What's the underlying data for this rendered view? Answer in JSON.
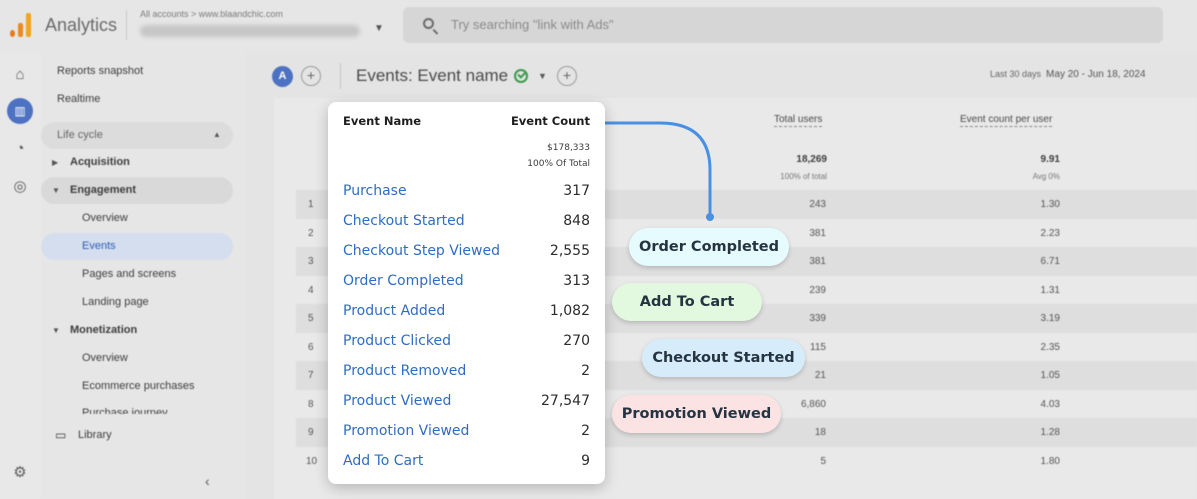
{
  "app": {
    "title": "Analytics",
    "breadcrumb": "All accounts > www.blaandchic.com",
    "search_placeholder": "Try searching \"link with Ads\""
  },
  "sidebar": {
    "reports_snapshot": "Reports snapshot",
    "realtime": "Realtime",
    "life_cycle": "Life cycle",
    "acquisition": "Acquisition",
    "engagement": "Engagement",
    "overview_1": "Overview",
    "events": "Events",
    "pages_and_screens": "Pages and screens",
    "landing_page": "Landing page",
    "monetization": "Monetization",
    "overview_2": "Overview",
    "ecommerce_purchases": "Ecommerce purchases",
    "purchase_journey": "Purchase journey",
    "library": "Library"
  },
  "report": {
    "avatar_letter": "A",
    "title": "Events: Event name",
    "date_label": "Last 30 days",
    "date_range": "May 20 - Jun 18, 2024"
  },
  "table": {
    "columns": [
      "Total users",
      "Event count per user"
    ],
    "totals": {
      "total_users": "18,269",
      "total_users_sub": "100% of total",
      "per_user": "9.91",
      "per_user_sub": "Avg 0%"
    },
    "rows": [
      {
        "n": "1",
        "users": "243",
        "per_user": "1.30"
      },
      {
        "n": "2",
        "users": "381",
        "per_user": "2.23"
      },
      {
        "n": "3",
        "users": "381",
        "per_user": "6.71"
      },
      {
        "n": "4",
        "users": "239",
        "per_user": "1.31"
      },
      {
        "n": "5",
        "users": "339",
        "per_user": "3.19"
      },
      {
        "n": "6",
        "users": "115",
        "per_user": "2.35"
      },
      {
        "n": "7",
        "users": "21",
        "per_user": "1.05"
      },
      {
        "n": "8",
        "users": "6,860",
        "per_user": "4.03"
      },
      {
        "n": "9",
        "users": "18",
        "per_user": "1.28"
      },
      {
        "n": "10",
        "users": "5",
        "per_user": "1.80"
      }
    ]
  },
  "card": {
    "col_name": "Event Name",
    "col_count": "Event Count",
    "total_value": "$178,333",
    "total_pct": "100% Of Total",
    "events": [
      {
        "name": "Purchase",
        "count": "317"
      },
      {
        "name": "Checkout Started",
        "count": "848"
      },
      {
        "name": "Checkout Step Viewed",
        "count": "2,555"
      },
      {
        "name": "Order Completed",
        "count": "313"
      },
      {
        "name": "Product Added",
        "count": "1,082"
      },
      {
        "name": "Product Clicked",
        "count": "270"
      },
      {
        "name": "Product Removed",
        "count": "2"
      },
      {
        "name": "Product Viewed",
        "count": "27,547"
      },
      {
        "name": "Promotion Viewed",
        "count": "2"
      },
      {
        "name": "Add To Cart",
        "count": "9"
      }
    ]
  },
  "callouts": [
    {
      "label": "Order Completed",
      "color": "#e6fbfd"
    },
    {
      "label": "Add To Cart",
      "color": "#e2f9df"
    },
    {
      "label": "Checkout Started",
      "color": "#d6ecfa"
    },
    {
      "label": "Promotion Viewed",
      "color": "#fbe3e4"
    }
  ],
  "colors": {
    "accent_blue": "#2f6cc4",
    "connector": "#4a90e2",
    "brand_orange": "#f0a21c"
  }
}
